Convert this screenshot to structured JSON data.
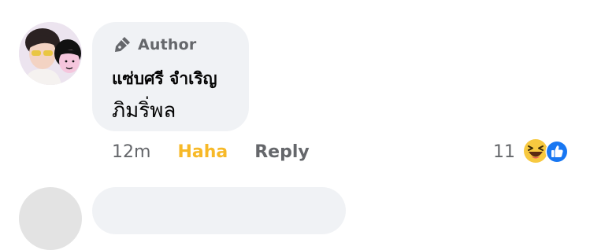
{
  "comment": {
    "badge": {
      "label": "Author",
      "icon": "pen-nib-icon"
    },
    "author_name": "แซ่บศรี จำเริญ",
    "text": "ภิมริ่พล",
    "time": "12m",
    "reaction_action": "Haha",
    "reply_label": "Reply",
    "reaction_count": "11",
    "reaction_icons": [
      "haha-emoji-icon",
      "like-thumb-icon"
    ]
  },
  "colors": {
    "bubble": "#f0f2f5",
    "secondary_text": "#65676b",
    "primary_text": "#050505",
    "haha": "#f7b928",
    "like": "#1877f2"
  }
}
